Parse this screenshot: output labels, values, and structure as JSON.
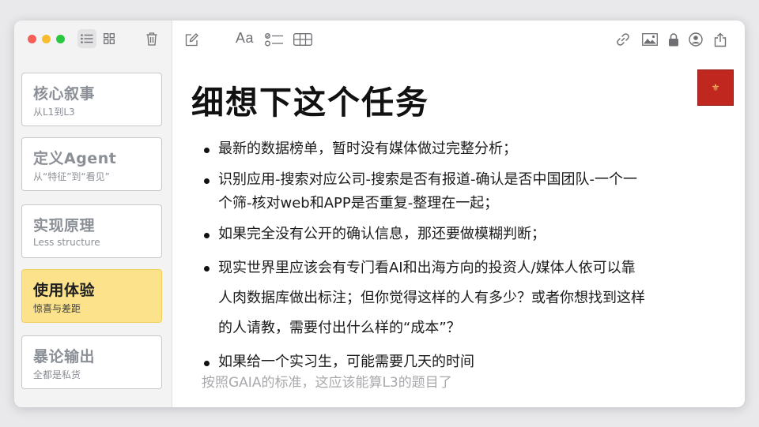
{
  "sidebar": {
    "cards": [
      {
        "title": "核心叙事",
        "subtitle": "从L1到L3",
        "selected": false
      },
      {
        "title": "定义Agent",
        "subtitle": "从“特征”到“看见”",
        "selected": false
      },
      {
        "title": "实现原理",
        "subtitle": "Less structure",
        "selected": false
      },
      {
        "title": "使用体验",
        "subtitle": "惊喜与差距",
        "selected": true
      },
      {
        "title": "暴论输出",
        "subtitle": "全都是私货",
        "selected": false
      }
    ]
  },
  "toolbar": {
    "format_label": "Aa",
    "icons": [
      "list-view-icon",
      "gallery-view-icon",
      "trash-icon",
      "compose-icon",
      "format-icon",
      "checklist-icon",
      "table-icon",
      "link-icon",
      "photo-icon",
      "lock-icon",
      "collaborate-icon",
      "share-icon"
    ]
  },
  "note": {
    "title": "细想下这个任务",
    "bullets": [
      "最新的数据榜单，暂时没有媒体做过完整分析；",
      "识别应用-搜索对应公司-搜索是否有报道-确认是否中国团队-一个一个筛-核对web和APP是否重复-整理在一起；",
      "如果完全没有公开的确认信息，那还要做模糊判断；",
      "现实世界里应该会有专门看AI和出海方向的投资人/媒体人依可以靠人肉数据库做出标注；但你觉得这样的人有多少？或者你想找到这样的人请教，需要付出什么样的“成本”？",
      "如果给一个实习生，可能需要几天的时间"
    ],
    "footnote": "按照GAIA的标准，这应该能算L3的题目了",
    "stamp_text": "Seal"
  },
  "colors": {
    "selected_card": "#fbe28b",
    "stamp": "#c0281f"
  }
}
